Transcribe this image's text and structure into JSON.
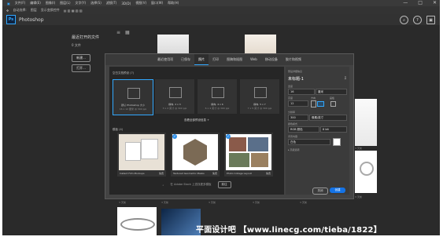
{
  "menu": [
    "文件(F)",
    "编辑(E)",
    "图像(I)",
    "图层(L)",
    "文字(Y)",
    "选择(S)",
    "滤镜(T)",
    "3D(D)",
    "视图(V)",
    "窗口(W)",
    "帮助(H)"
  ],
  "options_bar": [
    "自动选择:",
    "图层",
    "显示变换控件"
  ],
  "window_controls": {
    "minimize": "—",
    "maximize": "□",
    "close": "✕"
  },
  "app": {
    "logo": "Ps",
    "name": "Photoshop"
  },
  "home": {
    "title": "最近打开的文件",
    "subtitle": "0 文件",
    "new_button": "新建...",
    "open_button": "打开...",
    "view_toggle": [
      "≡",
      "▦"
    ]
  },
  "dialog": {
    "tabs": [
      "最近使用项",
      "已保存",
      "照片",
      "打印",
      "图稿和插图",
      "Web",
      "移动设备",
      "胶片和视频"
    ],
    "active_tab": 2,
    "presets_title": "空白文档预设 (7)",
    "presets": [
      {
        "name": "默认 Photoshop 大小",
        "size": "16 x 12 厘米 @ 300 ppi"
      },
      {
        "name": "横向, 2 x 3",
        "size": "3 x 2 英寸 @ 300 ppi"
      },
      {
        "name": "横向, 4 x 6",
        "size": "6 x 4 英寸 @ 300 ppi"
      },
      {
        "name": "横向, 5 x 7",
        "size": "7 x 5 英寸 @ 300 ppi"
      }
    ],
    "view_all": "查看全部预设信息 +",
    "templates_title": "模板 (4)",
    "templates": [
      {
        "name": "Instant Film Mockups",
        "badge": "免费"
      },
      {
        "name": "Textured Geometric Masks",
        "badge": "免费"
      },
      {
        "name": "Photo Collage Layout",
        "badge": "免费"
      }
    ],
    "search_placeholder": "在 Adobe Stock 上查找更多模板",
    "search_button": "前往",
    "details": {
      "title": "预设详细信息",
      "name": "未标题-1",
      "width_label": "宽度",
      "width_value": "16",
      "width_unit": "厘米",
      "height_label": "高度",
      "height_value": "12",
      "orientation_label": "方向",
      "artboard_label": "画板",
      "resolution_label": "分辨率",
      "resolution_value": "300",
      "resolution_unit": "像素/英寸",
      "color_mode_label": "颜色模式",
      "color_mode_value": "RGB 颜色",
      "bit_depth": "8 bit",
      "bg_label": "背景内容",
      "bg_value": "白色",
      "advanced": "▸ 高级选项",
      "close_button": "关闭",
      "create_button": "创建"
    }
  },
  "thumbnail_captions": [
    "3 天前",
    "3 天前",
    "3 天前",
    "3 天前",
    "3 天前",
    "3 天前",
    "3 天前"
  ],
  "watermark": "平面设计吧 【www.linecg.com/tieba/1822】",
  "colors": {
    "accent": "#31a8ff",
    "dialog_bg": "#434343",
    "frame_bg": "#2a2a2a"
  }
}
